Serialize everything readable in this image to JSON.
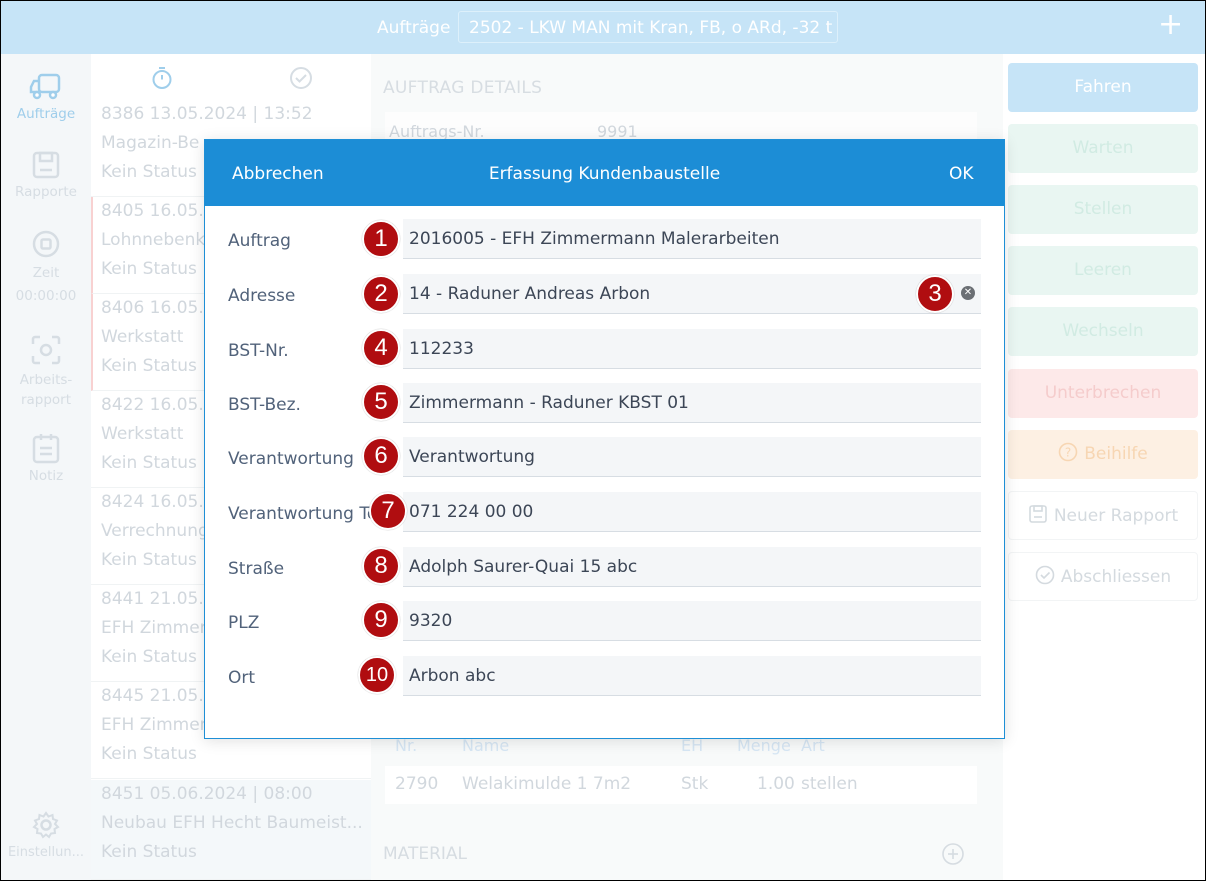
{
  "topbar": {
    "label": "Aufträge",
    "order_select": "2502 - LKW MAN mit Kran, FB, o ARd, -32 t",
    "add_symbol": "+"
  },
  "sidebar": {
    "items": [
      {
        "label": "Aufträge",
        "icon": "truck-icon"
      },
      {
        "label": "Rapporte",
        "icon": "save-icon"
      },
      {
        "label": "Zeit",
        "icon": "stop-icon",
        "value": "00:00:00"
      },
      {
        "label": "Arbeits-\nrapport",
        "icon": "scan-icon"
      },
      {
        "label": "Notiz",
        "icon": "clipboard-icon"
      },
      {
        "label": "Einstellun...",
        "icon": "gear-icon"
      }
    ]
  },
  "orders": [
    {
      "line1": "8386  13.05.2024 | 13:52",
      "line2": "Magazin-Be",
      "line3": "Kein Status"
    },
    {
      "line1": "8405  16.05.",
      "line2": "Lohnnebenk",
      "line3": "Kein Status"
    },
    {
      "line1": "8406  16.05.",
      "line2": "Werkstatt",
      "line3": "Kein Status"
    },
    {
      "line1": "8422  16.05.",
      "line2": "Werkstatt",
      "line3": "Kein Status"
    },
    {
      "line1": "8424  16.05.",
      "line2": "Verrechnung",
      "line3": "Kein Status"
    },
    {
      "line1": "8441  21.05.",
      "line2": "EFH Zimmer",
      "line3": "Kein Status"
    },
    {
      "line1": "8445  21.05.",
      "line2": "EFH Zimmer",
      "line3": "Kein Status"
    },
    {
      "line1": "8451  05.06.2024 | 08:00",
      "line2": "Neubau EFH Hecht Baumeist...",
      "line3": "Kein Status"
    }
  ],
  "details": {
    "title": "AUFTRAG DETAILS",
    "order_no_label": "Auftrags-Nr.",
    "order_no_value": "9991",
    "table_headers": [
      "Nr.",
      "Name",
      "EH",
      "Menge",
      "Art"
    ],
    "table_row": [
      "2790",
      "Welakimulde 1 7m2",
      "Stk",
      "1.00",
      "stellen"
    ],
    "material_title": "MATERIAL"
  },
  "actions": {
    "fahren": "Fahren",
    "warten": "Warten",
    "stellen": "Stellen",
    "leeren": "Leeren",
    "wechseln": "Wechseln",
    "unterbrechen": "Unterbrechen",
    "beihilfe": "Beihilfe",
    "neuer_rapport": "Neuer Rapport",
    "abschliessen": "Abschliessen"
  },
  "dialog": {
    "cancel": "Abbrechen",
    "title": "Erfassung Kundenbaustelle",
    "ok": "OK",
    "fields": [
      {
        "label": "Auftrag",
        "value": "2016005 - EFH Zimmermann Malerarbeiten"
      },
      {
        "label": "Adresse",
        "value": "14 - Raduner Andreas Arbon"
      },
      {
        "label": "BST-Nr.",
        "value": "112233"
      },
      {
        "label": "BST-Bez.",
        "value": "Zimmermann - Raduner KBST 01"
      },
      {
        "label": "Verantwortung",
        "value": "Verantwortung"
      },
      {
        "label": "Verantwortung Te",
        "value": "071 224 00 00"
      },
      {
        "label": "Straße",
        "value": "Adolph Saurer-Quai 15 abc"
      },
      {
        "label": "PLZ",
        "value": "9320"
      },
      {
        "label": "Ort",
        "value": "Arbon abc"
      }
    ]
  },
  "markers": [
    "1",
    "2",
    "3",
    "4",
    "5",
    "6",
    "7",
    "8",
    "9",
    "10"
  ],
  "colors": {
    "primary": "#1c8dd6",
    "topbar": "#bde0f6",
    "marker": "#b00d10"
  }
}
